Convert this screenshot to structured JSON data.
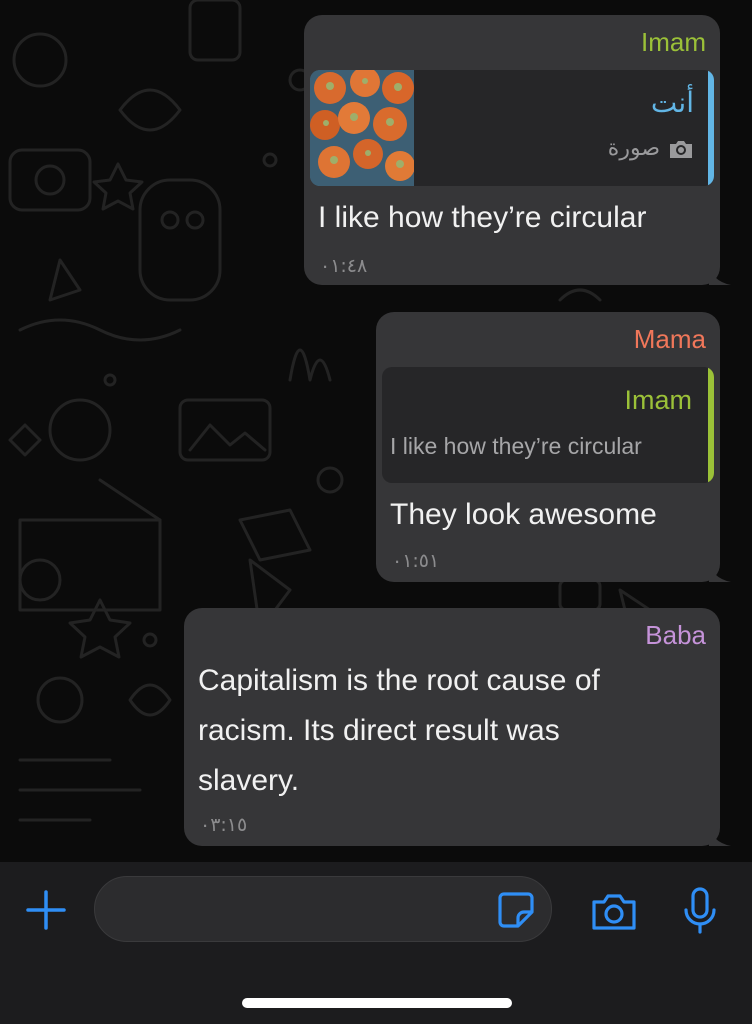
{
  "messages": [
    {
      "sender": "Imam",
      "sender_color": "#9bc138",
      "quoted": {
        "author": "أنت",
        "author_color": "#62b6e6",
        "photo_label": "صورة",
        "bar_color": "#62b6e6",
        "media": "photo-thumbnail"
      },
      "text": "I like how they’re circular",
      "time": "٠١:٤٨"
    },
    {
      "sender": "Mama",
      "sender_color": "#f0775a",
      "quoted": {
        "author": "Imam",
        "author_color": "#9bc138",
        "text": "I like how they’re circular",
        "bar_color": "#9bc138"
      },
      "text": "They look awesome",
      "time": "٠١:٥١"
    },
    {
      "sender": "Baba",
      "sender_color": "#c593d9",
      "text_lines": [
        "Capitalism is the root cause of",
        "racism.  Its direct result was",
        "slavery."
      ],
      "time": "٠٣:١٥"
    }
  ],
  "composer": {
    "input_value": "",
    "accent_color": "#2f8ef5",
    "icons": [
      "plus-icon",
      "sticker-icon",
      "camera-icon",
      "microphone-icon"
    ]
  }
}
